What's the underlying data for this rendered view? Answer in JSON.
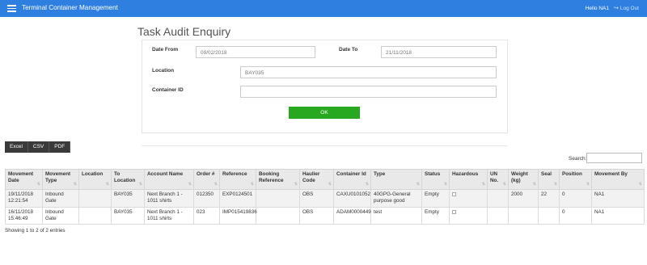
{
  "navbar": {
    "title": "Terminal Container Management",
    "greeting": "Hello NA1",
    "logout_label": "Log Out"
  },
  "page_title": "Task Audit Enquiry",
  "form": {
    "date_from_label": "Date From",
    "date_from_value": "09/02/2018",
    "date_to_label": "Date To",
    "date_to_value": "21/11/2018",
    "location_label": "Location",
    "location_value": "BAY035",
    "container_id_label": "Container ID",
    "container_id_value": "",
    "ok_label": "OK"
  },
  "export": {
    "excel": "Excel",
    "csv": "CSV",
    "pdf": "PDF"
  },
  "search": {
    "label": "Search:",
    "value": ""
  },
  "table": {
    "headers": [
      "Movement Date",
      "Movement Type",
      "Location",
      "To Location",
      "Account Name",
      "Order #",
      "Reference",
      "Booking Reference",
      "Haulier Code",
      "Container Id",
      "Type",
      "Status",
      "Hazardous",
      "UN No.",
      "Weight (kg)",
      "Seal",
      "Position",
      "Movement By"
    ],
    "rows": [
      [
        "19/11/2018 12:21:54",
        "Inbound Gate",
        "",
        "BAY035",
        "Next Branch 1 - 1011 shirts",
        "012350",
        "EXP0124501",
        "",
        "OBS",
        "CAXU0101052",
        "40GPG-General purpose good",
        "Empty",
        "",
        "",
        "2000",
        "22",
        "0",
        "NA1"
      ],
      [
        "16/11/2018 15:46:49",
        "Inbound Gate",
        "",
        "BAY035",
        "Next Branch 1 - 1011 shirts",
        "023",
        "IMP015419836",
        "",
        "OBS",
        "ADAM0000449",
        "test",
        "Empty",
        "",
        "",
        "",
        "",
        "0",
        "NA1"
      ]
    ]
  },
  "info": "Showing 1 to 2 of 2 entries"
}
